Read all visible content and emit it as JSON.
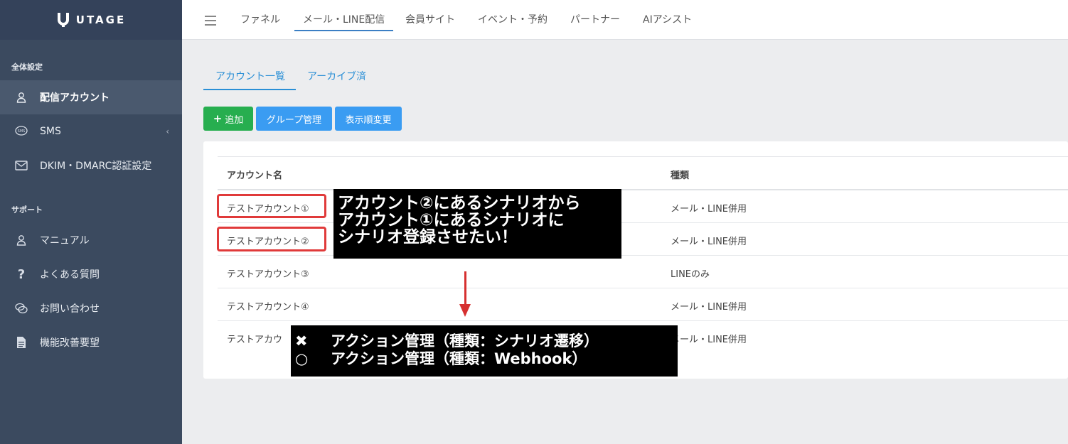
{
  "sidebar": {
    "logo": "UTAGE",
    "sections": [
      {
        "label": "全体設定"
      },
      {
        "label": "サポート"
      }
    ],
    "items": [
      {
        "label": "配信アカウント",
        "icon": "user-icon"
      },
      {
        "label": "SMS",
        "icon": "sms-icon"
      },
      {
        "label": "DKIM・DMARC認証設定",
        "icon": "mail-icon"
      },
      {
        "label": "マニュアル",
        "icon": "user-icon"
      },
      {
        "label": "よくある質問",
        "icon": "question-icon"
      },
      {
        "label": "お問い合わせ",
        "icon": "chat-icon"
      },
      {
        "label": "機能改善要望",
        "icon": "document-icon"
      }
    ]
  },
  "topnav": {
    "tabs": [
      "ファネル",
      "メール・LINE配信",
      "会員サイト",
      "イベント・予約",
      "パートナー",
      "AIアシスト"
    ]
  },
  "subtabs": [
    "アカウント一覧",
    "アーカイブ済"
  ],
  "actions": {
    "add": "追加",
    "group": "グループ管理",
    "order": "表示順変更"
  },
  "table": {
    "headers": [
      "アカウント名",
      "種類"
    ],
    "rows": [
      {
        "name": "テストアカウント①",
        "type": "メール・LINE併用"
      },
      {
        "name": "テストアカウント②",
        "type": "メール・LINE併用"
      },
      {
        "name": "テストアカウント③",
        "type": "LINEのみ"
      },
      {
        "name": "テストアカウント④",
        "type": "メール・LINE併用"
      },
      {
        "name": "テストアカウ",
        "type": "メール・LINE併用"
      }
    ]
  },
  "annotation1": {
    "lines": [
      "アカウント②にあるシナリオから",
      "アカウント①にあるシナリオに",
      "シナリオ登録させたい！"
    ]
  },
  "annotation2": {
    "lines": [
      {
        "mark": "✖",
        "text": "アクション管理（種類：シナリオ遷移）"
      },
      {
        "mark": "○",
        "text": "アクション管理（種類：Webhook）"
      }
    ]
  },
  "colors": {
    "sidebar": "#3b4a5f",
    "accent_blue": "#3a9cf2",
    "accent_green": "#27ae4f",
    "highlight_red": "#e03a3a"
  }
}
